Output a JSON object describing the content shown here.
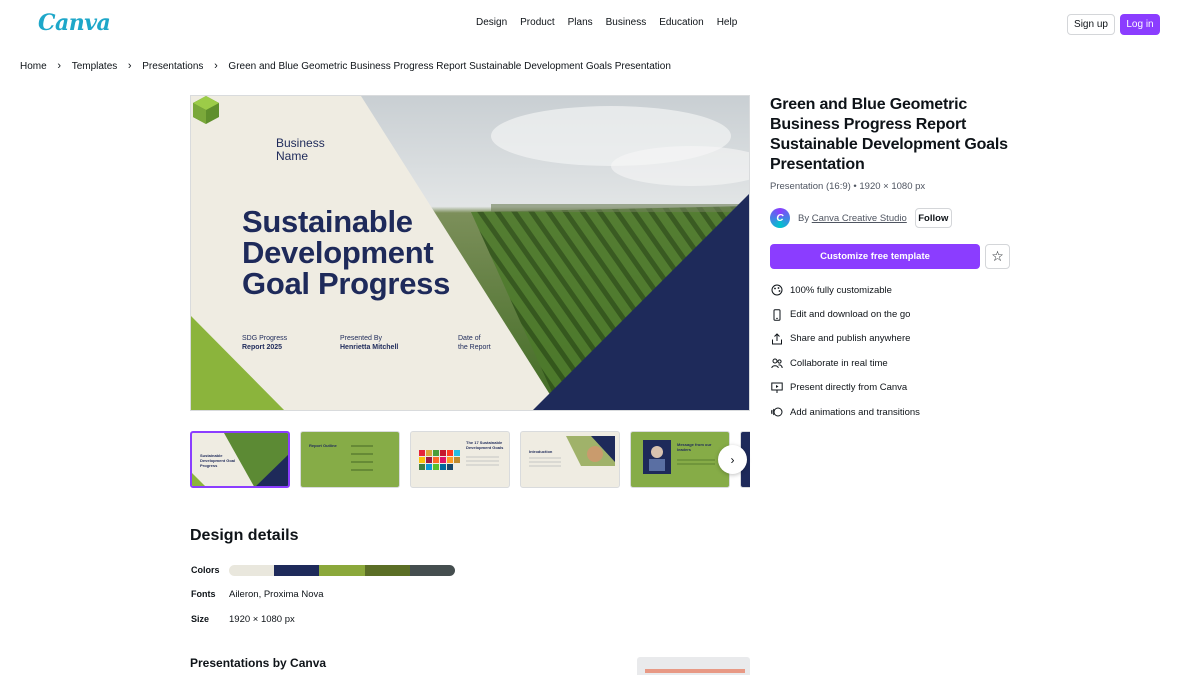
{
  "header": {
    "logo": "Canva",
    "nav": [
      "Design",
      "Product",
      "Plans",
      "Business",
      "Education",
      "Help"
    ],
    "sign_up": "Sign up",
    "log_in": "Log in"
  },
  "breadcrumb": [
    "Home",
    "Templates",
    "Presentations",
    "Green and Blue Geometric Business Progress Report Sustainable Development Goals Presentation"
  ],
  "preview": {
    "business_name": "Business Name",
    "title": "Sustainable Development Goal Progress",
    "meta1_line1": "SDG Progress",
    "meta1_line2": "Report 2025",
    "meta2_line1": "Presented By",
    "meta2_line2": "Henrietta Mitchell",
    "meta3_line1": "Date of",
    "meta3_line2": "the Report"
  },
  "thumbnails": [
    {
      "label": "Sustainable Development Goal Progress"
    },
    {
      "label": "Report Outline"
    },
    {
      "label": "The 17 Sustainable Development Goals"
    },
    {
      "label": "Introduction"
    },
    {
      "label": "Message from our leaders"
    }
  ],
  "template": {
    "title": "Green and Blue Geometric Business Progress Report Sustainable Development Goals Presentation",
    "subtitle": "Presentation (16:9) • 1920 × 1080 px",
    "by": "By",
    "author": "Canva Creative Studio",
    "follow": "Follow",
    "cta": "Customize free template"
  },
  "features": [
    {
      "icon": "palette-icon",
      "text": "100% fully customizable"
    },
    {
      "icon": "phone-icon",
      "text": "Edit and download on the go"
    },
    {
      "icon": "share-icon",
      "text": "Share and publish anywhere"
    },
    {
      "icon": "collaborate-icon",
      "text": "Collaborate in real time"
    },
    {
      "icon": "present-icon",
      "text": "Present directly from Canva"
    },
    {
      "icon": "animation-icon",
      "text": "Add animations and transitions"
    }
  ],
  "design_details": {
    "title": "Design details",
    "colors_label": "Colors",
    "colors": [
      "#e9e7dd",
      "#1e2a5a",
      "#8ba83b",
      "#5b6e26",
      "#454e4f"
    ],
    "fonts_label": "Fonts",
    "fonts_value": "Aileron, Proxima Nova",
    "size_label": "Size",
    "size_value": "1920 × 1080 px"
  },
  "more_title": "Presentations by Canva",
  "colors": {
    "accent": "#8b3dff",
    "navy": "#1e2a5a",
    "green": "#8bc34a"
  }
}
